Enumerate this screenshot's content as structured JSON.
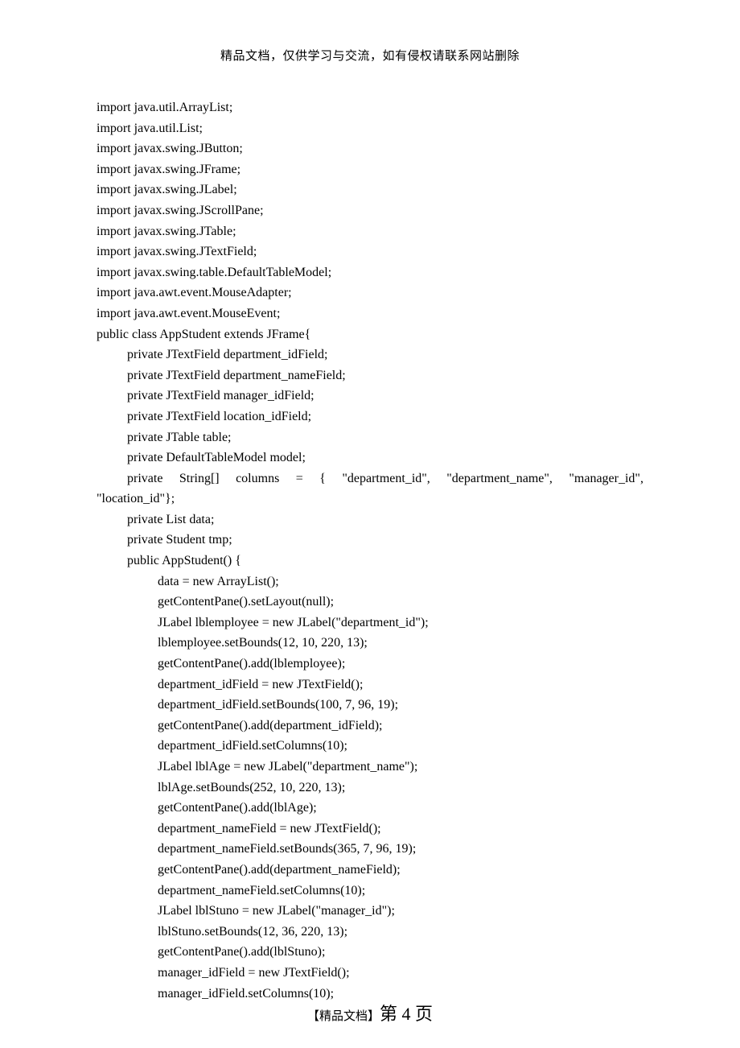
{
  "header": "精品文档，仅供学习与交流，如有侵权请联系网站删除",
  "footer_prefix": "【精品文档】",
  "footer_page_label": "第 4 页",
  "code": {
    "l01": "import java.util.ArrayList;",
    "l02": "import java.util.List;",
    "l03": "import javax.swing.JButton;",
    "l04": "import javax.swing.JFrame;",
    "l05": "import javax.swing.JLabel;",
    "l06": "import javax.swing.JScrollPane;",
    "l07": "import javax.swing.JTable;",
    "l08": "import javax.swing.JTextField;",
    "l09": "import javax.swing.table.DefaultTableModel;",
    "l10": "import java.awt.event.MouseAdapter;",
    "l11": "import java.awt.event.MouseEvent;",
    "l12": "public class AppStudent extends JFrame{",
    "l13": "private JTextField department_idField;",
    "l14": "private JTextField department_nameField;",
    "l15": "private JTextField manager_idField;",
    "l16": "private JTextField location_idField;",
    "l17": "private JTable table;",
    "l18": "private DefaultTableModel model;",
    "l19a": "private",
    "l19b": "String[]",
    "l19c": "columns",
    "l19d": "=",
    "l19e": "{",
    "l19f": "\"department_id\",",
    "l19g": "\"department_name\",",
    "l19h": "\"manager_id\",",
    "l20": "\"location_id\"};",
    "l21": "private List data;",
    "l22": "private Student tmp;",
    "l23": "public AppStudent() {",
    "l24": "data = new ArrayList();",
    "l25": "getContentPane().setLayout(null);",
    "l26": "JLabel lblemployee = new JLabel(\"department_id\");",
    "l27": "lblemployee.setBounds(12, 10, 220, 13);",
    "l28": "getContentPane().add(lblemployee);",
    "l29": "department_idField = new JTextField();",
    "l30": "department_idField.setBounds(100, 7, 96, 19);",
    "l31": "getContentPane().add(department_idField);",
    "l32": "department_idField.setColumns(10);",
    "l33": "JLabel lblAge = new JLabel(\"department_name\");",
    "l34": "lblAge.setBounds(252, 10, 220, 13);",
    "l35": "getContentPane().add(lblAge);",
    "l36": "department_nameField = new JTextField();",
    "l37": "department_nameField.setBounds(365, 7, 96, 19);",
    "l38": "getContentPane().add(department_nameField);",
    "l39": "department_nameField.setColumns(10);",
    "l40": "JLabel lblStuno = new JLabel(\"manager_id\");",
    "l41": "lblStuno.setBounds(12, 36, 220, 13);",
    "l42": "getContentPane().add(lblStuno);",
    "l43": "manager_idField = new JTextField();",
    "l44": "manager_idField.setColumns(10);"
  }
}
